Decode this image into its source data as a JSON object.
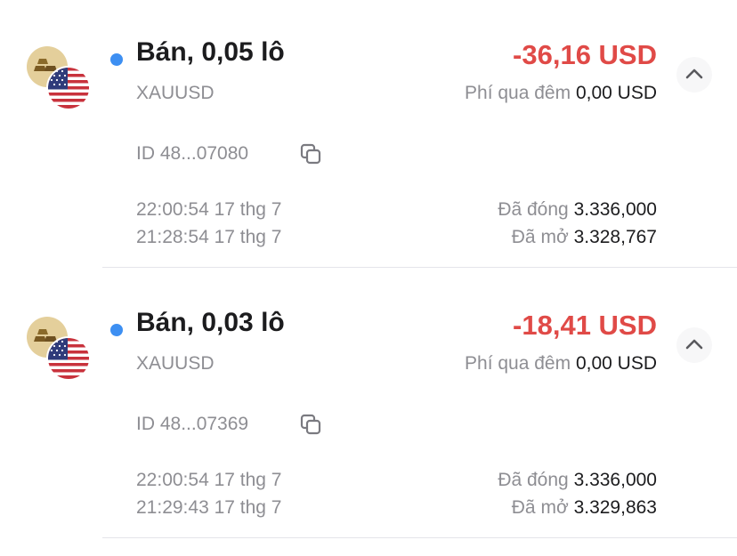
{
  "colors": {
    "accent_dot": "#3d8ff2",
    "loss": "#e04a47",
    "muted": "#8e8e93",
    "text": "#1c1c1e"
  },
  "positions": [
    {
      "side_size": "Bán, 0,05 lô",
      "symbol": "XAUUSD",
      "pnl": "-36,16 USD",
      "swap_label": "Phí qua đêm",
      "swap_value": "0,00 USD",
      "id_text": "ID 48...07080",
      "close_time": "22:00:54 17 thg 7",
      "open_time": "21:28:54 17 thg 7",
      "close_label": "Đã đóng",
      "close_price": "3.336,000",
      "open_label": "Đã mở",
      "open_price": "3.328,767",
      "icons": [
        "gold-bars-icon",
        "us-flag-icon",
        "chevron-up-icon",
        "copy-icon"
      ]
    },
    {
      "side_size": "Bán, 0,03 lô",
      "symbol": "XAUUSD",
      "pnl": "-18,41 USD",
      "swap_label": "Phí qua đêm",
      "swap_value": "0,00 USD",
      "id_text": "ID 48...07369",
      "close_time": "22:00:54 17 thg 7",
      "open_time": "21:29:43 17 thg 7",
      "close_label": "Đã đóng",
      "close_price": "3.336,000",
      "open_label": "Đã mở",
      "open_price": "3.329,863",
      "icons": [
        "gold-bars-icon",
        "us-flag-icon",
        "chevron-up-icon",
        "copy-icon"
      ]
    }
  ]
}
